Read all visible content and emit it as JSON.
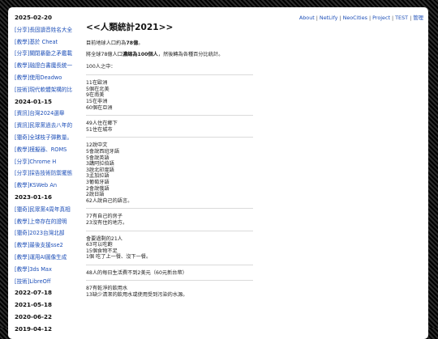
{
  "nav": {
    "items": [
      "About",
      "NetLify",
      "NeoCities",
      "Project",
      "TEST",
      "管理"
    ]
  },
  "sidebar": {
    "entries": [
      {
        "type": "date",
        "text": "2025-02-20"
      },
      {
        "type": "link",
        "text": "[分享]長固讀音姓名大全"
      },
      {
        "type": "link",
        "text": "[教學]基於 Cheat"
      },
      {
        "type": "link",
        "text": "[分享]關閉暴動之矛鑑載"
      },
      {
        "type": "link",
        "text": "[教學]融證白書魔長統一"
      },
      {
        "type": "link",
        "text": "[教學]使用Deadwo"
      },
      {
        "type": "link",
        "text": "[技術]現代軟體架構的比"
      },
      {
        "type": "date",
        "text": "2024-01-15"
      },
      {
        "type": "link",
        "text": "[資訊]台灣2024選舉"
      },
      {
        "type": "link",
        "text": "[資訊]民眾黨過去八年的"
      },
      {
        "type": "link",
        "text": "[獵奇]全球枝子彈數量。"
      },
      {
        "type": "link",
        "text": "[教學]模擬器、ROMS"
      },
      {
        "type": "link",
        "text": "[分享]Chrome H"
      },
      {
        "type": "link",
        "text": "[分享]採告技術防禦擺態"
      },
      {
        "type": "link",
        "text": "[教學]KSWeb An"
      },
      {
        "type": "date",
        "text": "2023-01-16"
      },
      {
        "type": "link",
        "text": "[獵奇]民眾黨4周年真相"
      },
      {
        "type": "link",
        "text": "[教學]上帝存在的證明"
      },
      {
        "type": "link",
        "text": "[獵奇]2023台灣北部"
      },
      {
        "type": "link",
        "text": "[教學]最後支援sse2"
      },
      {
        "type": "link",
        "text": "[教學]運用AI圖像生成"
      },
      {
        "type": "link",
        "text": "[教學]3ds Max"
      },
      {
        "type": "link",
        "text": "[技術]LibreOff"
      },
      {
        "type": "date",
        "text": "2022-07-18"
      },
      {
        "type": "date",
        "text": "2021-05-18"
      },
      {
        "type": "date",
        "text": "2020-06-22"
      },
      {
        "type": "date",
        "text": "2019-04-12"
      }
    ]
  },
  "article": {
    "title": "<<人類統計2021>>",
    "intro": {
      "line1_prefix": "目前地球人口約為",
      "line1_bold": "78億",
      "line1_suffix": "。",
      "line2_prefix": "將全球78億人口",
      "line2_bold": "濃縮為100個人",
      "line2_suffix": "，然後轉為各種百分比統計。",
      "line3": "100人之中："
    },
    "groups": [
      [
        "11在歐洲",
        "5個在北美",
        "9在南美",
        "15在非洲",
        "60個在亞洲"
      ],
      [
        "49人住在鄉下",
        "51住在城市"
      ],
      [
        "12說中文",
        "5會說西班牙語",
        "5會說英語",
        "3講阿拉伯語",
        "3說北印度語",
        "3孟加拉語",
        "3葡萄牙語",
        "2會說俄語",
        "2說日語",
        "62人說自己的語言。"
      ],
      [
        "77有自己的房子",
        "23沒有住的地方。"
      ],
      [
        "會要過剩的21人",
        "63可以吃飽",
        "15個食物不足",
        "1個 吃了上一餐、沒下一餐。"
      ],
      [
        "48人的每日生活費不到2美元（60元新台幣）"
      ],
      [
        "87有乾淨的飲用水",
        "13缺少清潔的飲用水或使用受到污染的水源。"
      ]
    ]
  }
}
